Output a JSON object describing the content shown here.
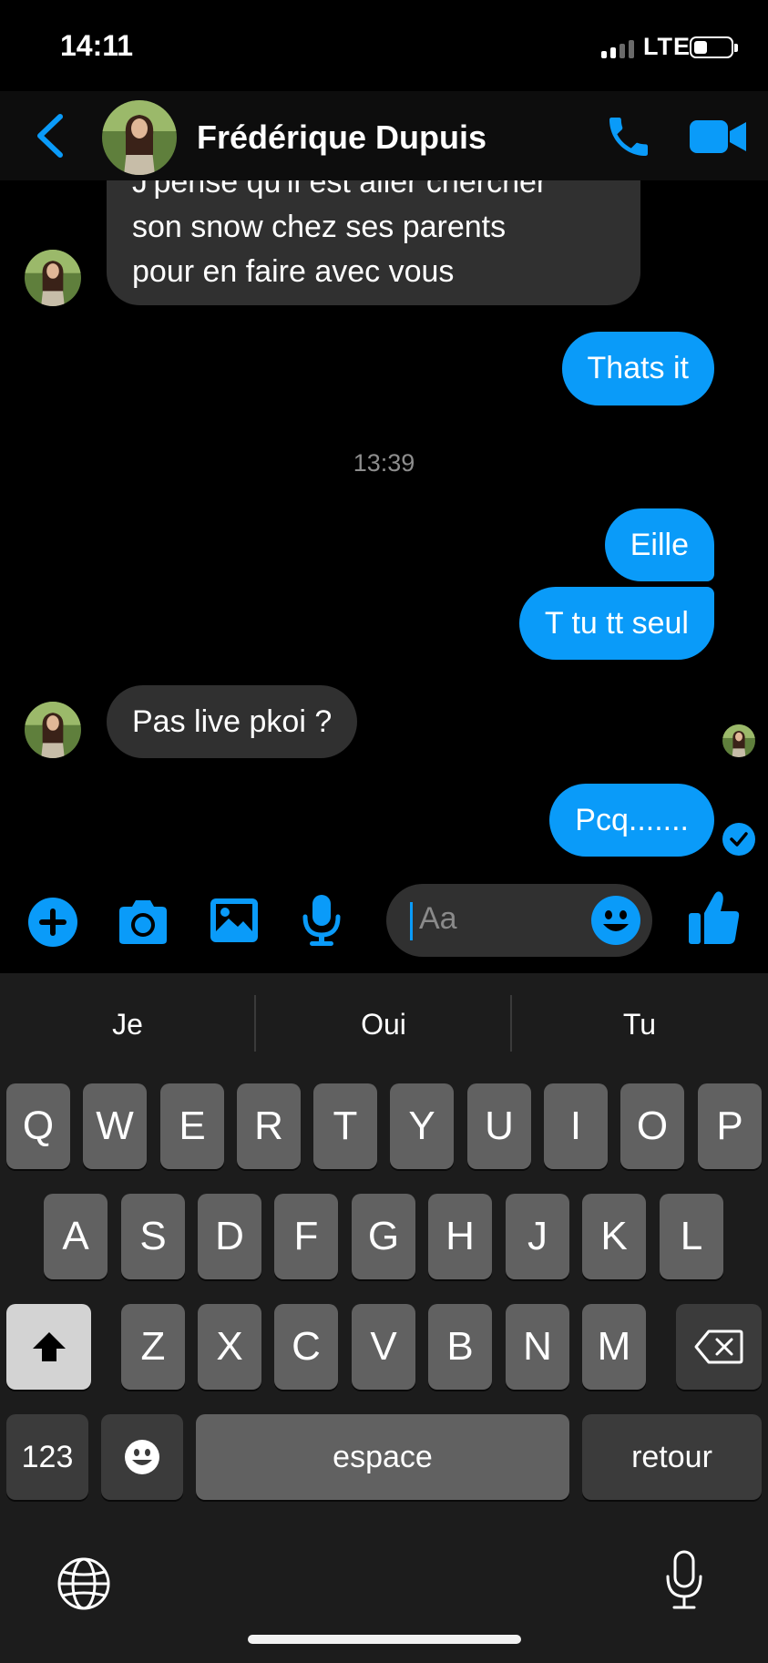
{
  "status_bar": {
    "time": "14:11",
    "network": "LTE",
    "signal_bars_active": 2,
    "signal_bars_total": 4
  },
  "header": {
    "contact_name": "Frédérique Dupuis",
    "back_icon": "chevron-left-icon",
    "call_icon": "phone-icon",
    "video_icon": "video-camera-icon"
  },
  "messages": [
    {
      "direction": "in",
      "lines": [
        "J'pense qu'il est aller chercher",
        "son snow chez ses parents",
        "pour en faire avec vous"
      ]
    },
    {
      "direction": "out",
      "text": "Thats it"
    },
    {
      "direction": "time",
      "text": "13:39"
    },
    {
      "direction": "out",
      "text": "Eille"
    },
    {
      "direction": "out",
      "text": "T tu tt seul"
    },
    {
      "direction": "in",
      "text": "Pas live pkoi ?"
    },
    {
      "direction": "out",
      "text": "Pcq......."
    }
  ],
  "composer": {
    "placeholder": "Aa",
    "icons": [
      "plus-icon",
      "camera-icon",
      "image-icon",
      "microphone-icon",
      "emoji-icon",
      "thumbs-up-icon"
    ]
  },
  "keyboard": {
    "predictions": [
      "Je",
      "Oui",
      "Tu"
    ],
    "row1": [
      "Q",
      "W",
      "E",
      "R",
      "T",
      "Y",
      "U",
      "I",
      "O",
      "P"
    ],
    "row2": [
      "A",
      "S",
      "D",
      "F",
      "G",
      "H",
      "J",
      "K",
      "L"
    ],
    "row3": [
      "Z",
      "X",
      "C",
      "V",
      "B",
      "N",
      "M"
    ],
    "numbers_label": "123",
    "space_label": "espace",
    "return_label": "retour"
  },
  "colors": {
    "accent": "#0a9bf9",
    "incoming_bubble": "#303030",
    "background": "#000000",
    "keyboard_bg": "#1c1c1c"
  }
}
